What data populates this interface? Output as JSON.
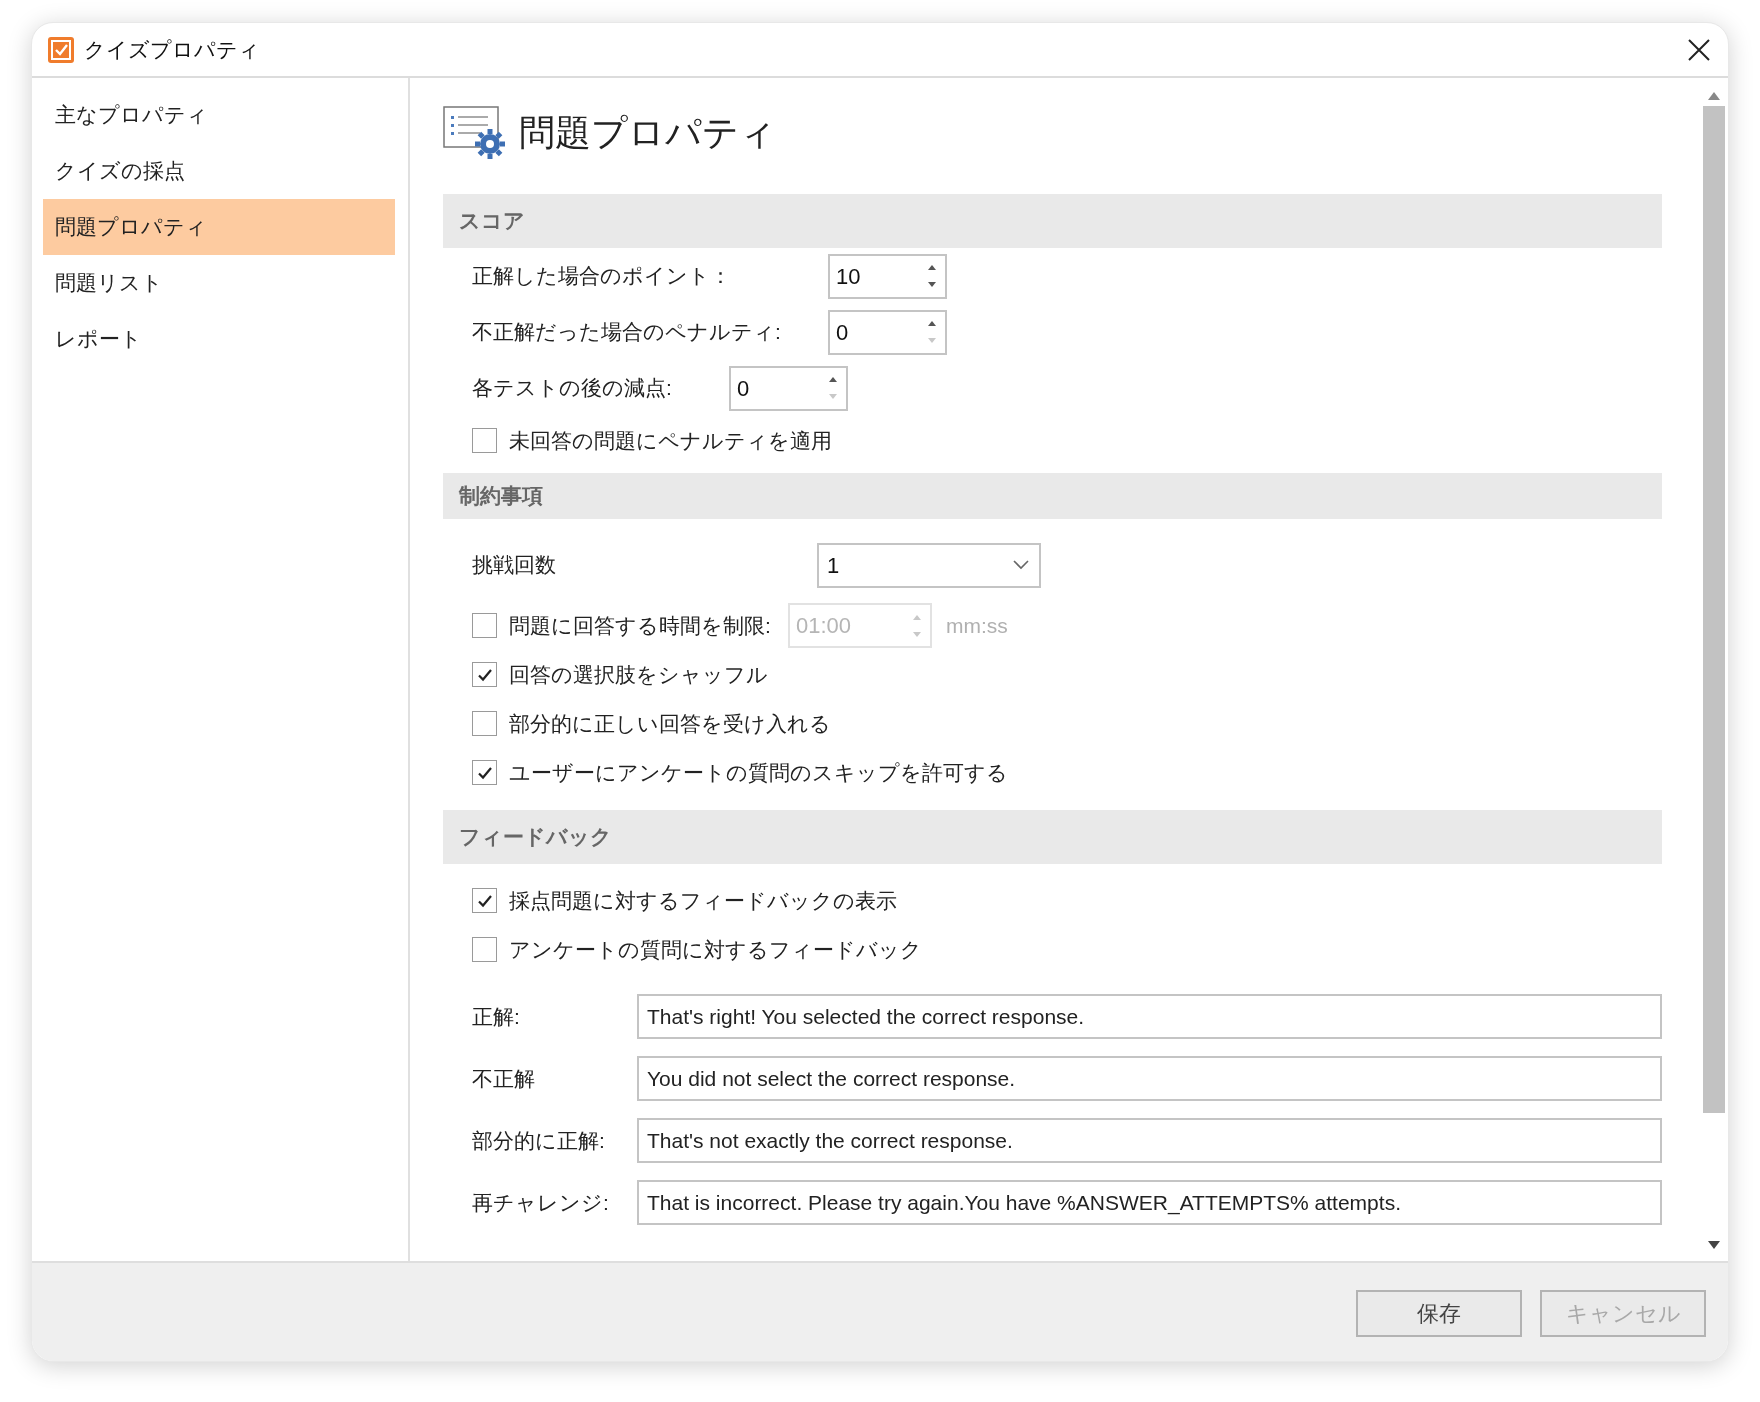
{
  "window": {
    "title": "クイズプロパティ"
  },
  "sidebar": {
    "items": [
      {
        "label": "主なプロパティ",
        "selected": false
      },
      {
        "label": "クイズの採点",
        "selected": false
      },
      {
        "label": "問題プロパティ",
        "selected": true
      },
      {
        "label": "問題リスト",
        "selected": false
      },
      {
        "label": "レポート",
        "selected": false
      }
    ]
  },
  "page_title": "問題プロパティ",
  "sections": [
    {
      "title": "スコア",
      "rows": [
        {
          "kind": "spinner",
          "label": "正解した場合のポイント：",
          "value": "10",
          "at_minimum": false
        },
        {
          "kind": "spinner",
          "label": "不正解だった場合のペナルティ:",
          "value": "0",
          "at_minimum": true
        },
        {
          "kind": "spinner",
          "label": "各テストの後の減点:",
          "value": "0",
          "at_minimum": true
        },
        {
          "kind": "checkbox",
          "label": "未回答の問題にペナルティを適用",
          "checked": false
        }
      ]
    },
    {
      "title": "制約事項",
      "rows": [
        {
          "kind": "dropdown",
          "label": "挑戦回数",
          "value": "1"
        },
        {
          "kind": "timed_checkbox",
          "label": "問題に回答する時間を制限:",
          "checked": false,
          "value": "01:00",
          "unit": "mm:ss",
          "disabled": true
        },
        {
          "kind": "checkbox",
          "label": "回答の選択肢をシャッフル",
          "checked": true
        },
        {
          "kind": "checkbox",
          "label": "部分的に正しい回答を受け入れる",
          "checked": false
        },
        {
          "kind": "checkbox",
          "label": "ユーザーにアンケートの質問のスキップを許可する",
          "checked": true
        }
      ]
    },
    {
      "title": "フィードバック",
      "rows": [
        {
          "kind": "checkbox",
          "label": "採点問題に対するフィードバックの表示",
          "checked": true
        },
        {
          "kind": "checkbox",
          "label": "アンケートの質問に対するフィードバック",
          "checked": false
        },
        {
          "kind": "text_field",
          "label": "正解:",
          "value": "That's right! You selected the correct response."
        },
        {
          "kind": "text_field",
          "label": "不正解",
          "value": "You did not select the correct response."
        },
        {
          "kind": "text_field",
          "label": "部分的に正解:",
          "value": "That's not exactly the correct response."
        },
        {
          "kind": "text_field",
          "label": "再チャレンジ:",
          "value": "That is incorrect. Please try again.You have %ANSWER_ATTEMPTS% attempts."
        }
      ]
    }
  ],
  "buttons": [
    {
      "label": "保存",
      "disabled": false
    },
    {
      "label": "キャンセル",
      "disabled": true
    }
  ]
}
